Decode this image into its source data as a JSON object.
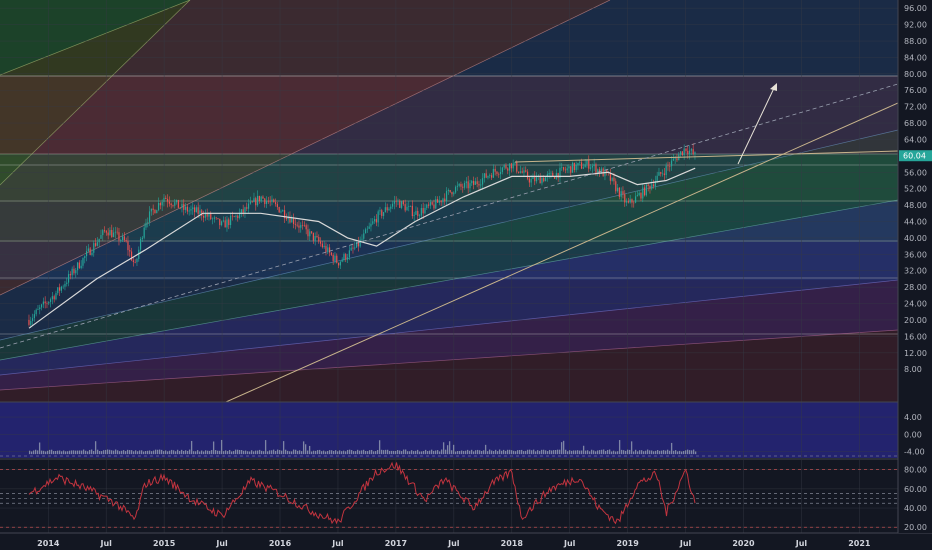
{
  "chart_data": [
    {
      "type": "candlestick",
      "panel": "price",
      "ylim": [
        0,
        98
      ],
      "yticks": [
        "96.00",
        "92.00",
        "88.00",
        "84.00",
        "80.00",
        "76.00",
        "72.00",
        "68.00",
        "64.00",
        "60.00",
        "56.00",
        "52.00",
        "48.00",
        "44.00",
        "40.00",
        "36.00",
        "32.00",
        "28.00",
        "24.00",
        "20.00",
        "16.00",
        "12.00",
        "8.00"
      ],
      "last_price_label": "60.04",
      "last_price": 60.04,
      "grid": true,
      "approx_closes": [
        {
          "x": "2013-11",
          "y": 20
        },
        {
          "x": "2014-02",
          "y": 27
        },
        {
          "x": "2014-05",
          "y": 36
        },
        {
          "x": "2014-07",
          "y": 42
        },
        {
          "x": "2014-09",
          "y": 39
        },
        {
          "x": "2014-10",
          "y": 33
        },
        {
          "x": "2014-11",
          "y": 44
        },
        {
          "x": "2015-01",
          "y": 50
        },
        {
          "x": "2015-03",
          "y": 47
        },
        {
          "x": "2015-05",
          "y": 46
        },
        {
          "x": "2015-07",
          "y": 43
        },
        {
          "x": "2015-09",
          "y": 46
        },
        {
          "x": "2015-11",
          "y": 50
        },
        {
          "x": "2016-01",
          "y": 47
        },
        {
          "x": "2016-03",
          "y": 43
        },
        {
          "x": "2016-05",
          "y": 39
        },
        {
          "x": "2016-07",
          "y": 34
        },
        {
          "x": "2016-09",
          "y": 38
        },
        {
          "x": "2016-11",
          "y": 45
        },
        {
          "x": "2017-01",
          "y": 49
        },
        {
          "x": "2017-03",
          "y": 46
        },
        {
          "x": "2017-05",
          "y": 48
        },
        {
          "x": "2017-07",
          "y": 52
        },
        {
          "x": "2017-09",
          "y": 53
        },
        {
          "x": "2017-11",
          "y": 56
        },
        {
          "x": "2018-01",
          "y": 58
        },
        {
          "x": "2018-03",
          "y": 54
        },
        {
          "x": "2018-05",
          "y": 55
        },
        {
          "x": "2018-07",
          "y": 57
        },
        {
          "x": "2018-09",
          "y": 58
        },
        {
          "x": "2018-11",
          "y": 55
        },
        {
          "x": "2019-01",
          "y": 48
        },
        {
          "x": "2019-03",
          "y": 52
        },
        {
          "x": "2019-05",
          "y": 57
        },
        {
          "x": "2019-07",
          "y": 62
        },
        {
          "x": "2019-08",
          "y": 60
        }
      ],
      "moving_average": [
        {
          "x": "2013-11",
          "y": 18
        },
        {
          "x": "2014-06",
          "y": 30
        },
        {
          "x": "2014-11",
          "y": 37
        },
        {
          "x": "2015-05",
          "y": 46
        },
        {
          "x": "2015-11",
          "y": 46
        },
        {
          "x": "2016-05",
          "y": 44
        },
        {
          "x": "2016-08",
          "y": 40
        },
        {
          "x": "2016-11",
          "y": 38
        },
        {
          "x": "2017-03",
          "y": 44
        },
        {
          "x": "2017-08",
          "y": 50
        },
        {
          "x": "2018-01",
          "y": 55
        },
        {
          "x": "2018-07",
          "y": 55
        },
        {
          "x": "2018-11",
          "y": 56
        },
        {
          "x": "2019-02",
          "y": 53
        },
        {
          "x": "2019-05",
          "y": 54
        },
        {
          "x": "2019-08",
          "y": 57
        }
      ]
    },
    {
      "type": "histogram",
      "panel": "macd",
      "ylim": [
        -5.5,
        7.5
      ],
      "yticks": [
        "4.00",
        "0.00",
        "-4.00"
      ],
      "grid": true
    },
    {
      "type": "line",
      "panel": "rsi",
      "ylim": [
        14,
        90
      ],
      "yticks": [
        "80.00",
        "60.00",
        "40.00",
        "20.00"
      ],
      "reference_levels": [
        80,
        55,
        50,
        45,
        20
      ],
      "approx_values": [
        {
          "x": "2013-11",
          "y": 55
        },
        {
          "x": "2014-02",
          "y": 72
        },
        {
          "x": "2014-05",
          "y": 60
        },
        {
          "x": "2014-08",
          "y": 45
        },
        {
          "x": "2014-10",
          "y": 28
        },
        {
          "x": "2014-11",
          "y": 65
        },
        {
          "x": "2015-01",
          "y": 72
        },
        {
          "x": "2015-04",
          "y": 48
        },
        {
          "x": "2015-07",
          "y": 32
        },
        {
          "x": "2015-10",
          "y": 68
        },
        {
          "x": "2016-01",
          "y": 55
        },
        {
          "x": "2016-04",
          "y": 38
        },
        {
          "x": "2016-07",
          "y": 25
        },
        {
          "x": "2016-09",
          "y": 52
        },
        {
          "x": "2016-11",
          "y": 78
        },
        {
          "x": "2017-01",
          "y": 85
        },
        {
          "x": "2017-04",
          "y": 48
        },
        {
          "x": "2017-06",
          "y": 70
        },
        {
          "x": "2017-09",
          "y": 40
        },
        {
          "x": "2017-11",
          "y": 65
        },
        {
          "x": "2018-01",
          "y": 78
        },
        {
          "x": "2018-02",
          "y": 30
        },
        {
          "x": "2018-05",
          "y": 60
        },
        {
          "x": "2018-08",
          "y": 72
        },
        {
          "x": "2018-10",
          "y": 40
        },
        {
          "x": "2018-12",
          "y": 25
        },
        {
          "x": "2019-02",
          "y": 65
        },
        {
          "x": "2019-04",
          "y": 75
        },
        {
          "x": "2019-05",
          "y": 35
        },
        {
          "x": "2019-07",
          "y": 80
        },
        {
          "x": "2019-08",
          "y": 45
        }
      ]
    }
  ],
  "x_axis": {
    "start": "2013-08",
    "end": "2021-05",
    "ticks": [
      {
        "label": "2014",
        "x": "2014-01"
      },
      {
        "label": "Jul",
        "x": "2014-07"
      },
      {
        "label": "2015",
        "x": "2015-01"
      },
      {
        "label": "Jul",
        "x": "2015-07"
      },
      {
        "label": "2016",
        "x": "2016-01"
      },
      {
        "label": "Jul",
        "x": "2016-07"
      },
      {
        "label": "2017",
        "x": "2017-01"
      },
      {
        "label": "Jul",
        "x": "2017-07"
      },
      {
        "label": "2018",
        "x": "2018-01"
      },
      {
        "label": "Jul",
        "x": "2018-07"
      },
      {
        "label": "2019",
        "x": "2019-01"
      },
      {
        "label": "Jul",
        "x": "2019-07"
      },
      {
        "label": "2020",
        "x": "2020-01"
      },
      {
        "label": "Jul",
        "x": "2020-07"
      },
      {
        "label": "2021",
        "x": "2021-01"
      }
    ]
  },
  "colors": {
    "background": "#131722",
    "candle_up": "#26a69a",
    "candle_down": "#ef5350",
    "moving_average": "#d9d9d9",
    "rsi_line": "#c2343f",
    "price_tag": "#26a69a",
    "trendline": "#c8b48c"
  }
}
